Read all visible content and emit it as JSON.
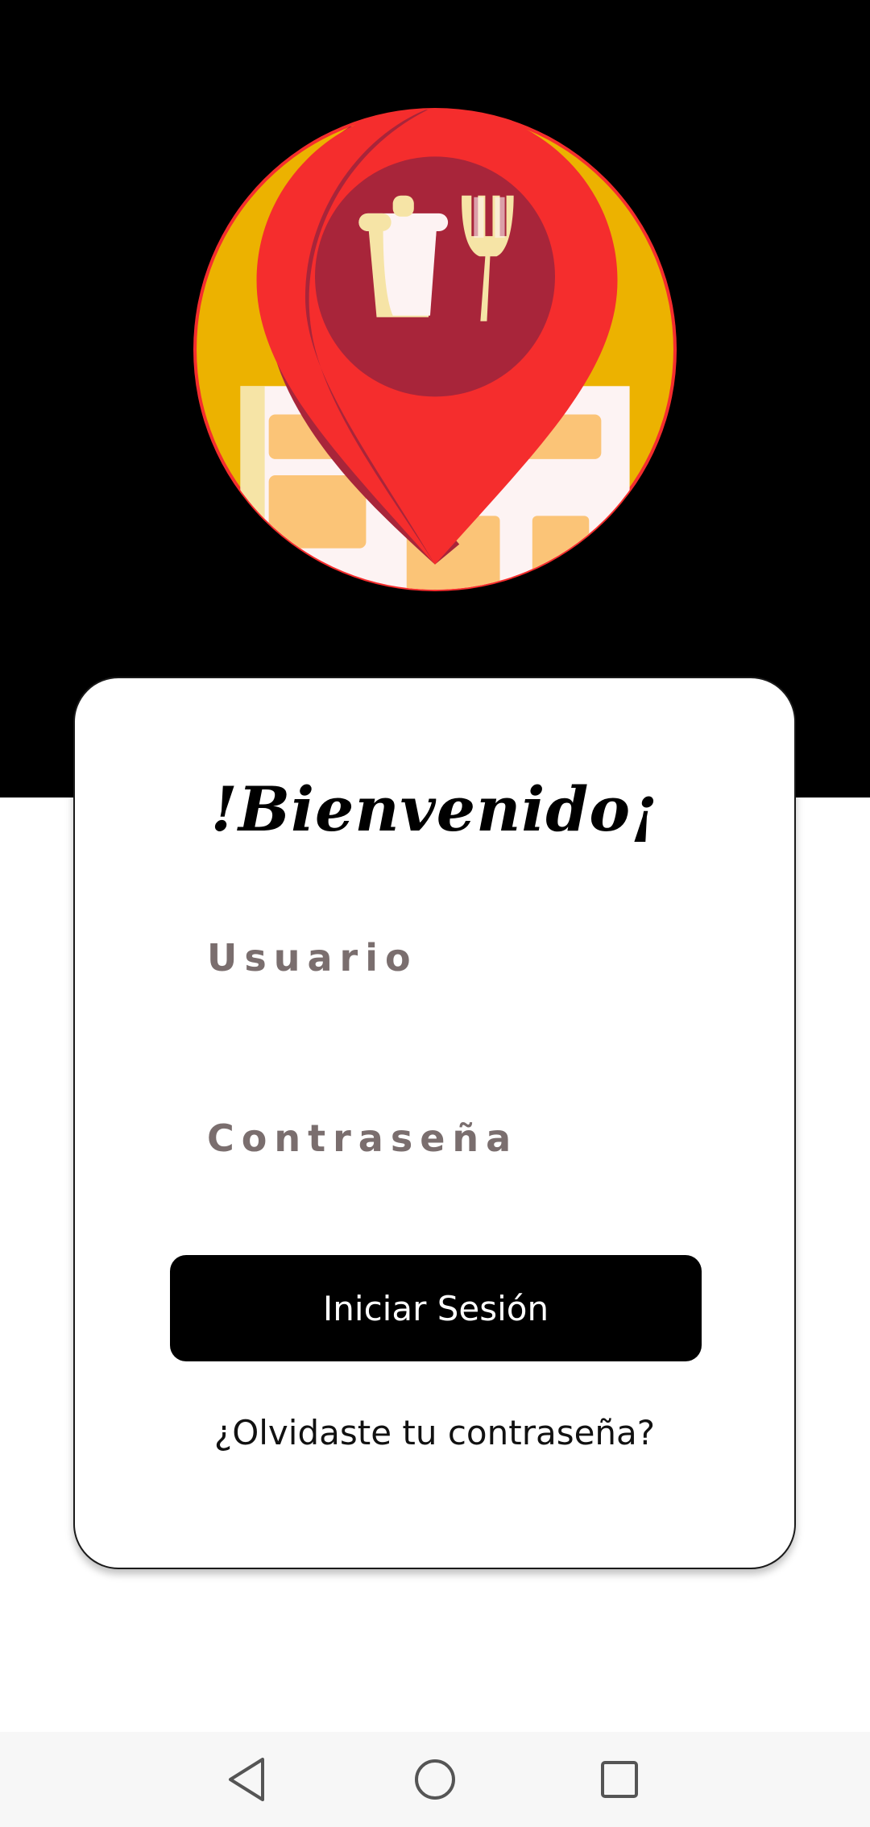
{
  "login": {
    "welcome_title": "!Bienvenido¡",
    "username_placeholder": "Usuario",
    "password_placeholder": "Contraseña",
    "login_button": "Iniciar Sesión",
    "forgot_password": "¿Olvidaste tu contraseña?"
  },
  "logo": {
    "icon": "food-location-pin-icon"
  },
  "navigation_bar": {
    "back_icon": "back-triangle-icon",
    "home_icon": "home-circle-icon",
    "recents_icon": "recents-square-icon"
  },
  "colors": {
    "top_band": "#000000",
    "logo_yellow": "#ecb200",
    "pin_red": "#f52d2d",
    "pin_dark_red": "#a8253a",
    "button": "#000000",
    "placeholder_text": "#7a6e6e"
  }
}
